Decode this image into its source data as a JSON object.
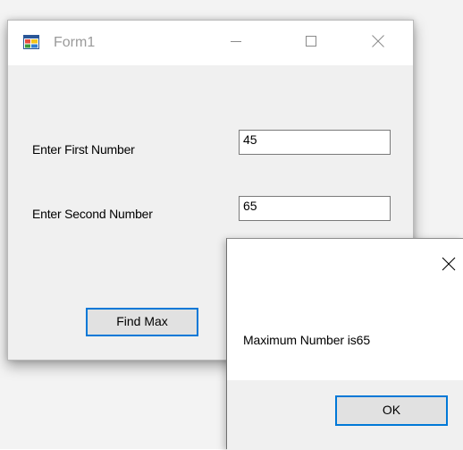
{
  "form1": {
    "title": "Form1",
    "labels": {
      "first": "Enter First Number",
      "second": "Enter Second Number"
    },
    "inputs": {
      "first_value": "45",
      "second_value": "65"
    },
    "find_button_label": "Find Max",
    "icons": {
      "app": "winforms-app-icon",
      "minimize": "minimize-icon",
      "maximize": "maximize-icon",
      "close": "close-icon"
    }
  },
  "message_box": {
    "text": "Maximum Number is65",
    "ok_label": "OK",
    "close_icon": "close-icon"
  },
  "colors": {
    "accent": "#0078d7",
    "button_face": "#e1e1e1",
    "window_bg": "#f0f0f0"
  }
}
